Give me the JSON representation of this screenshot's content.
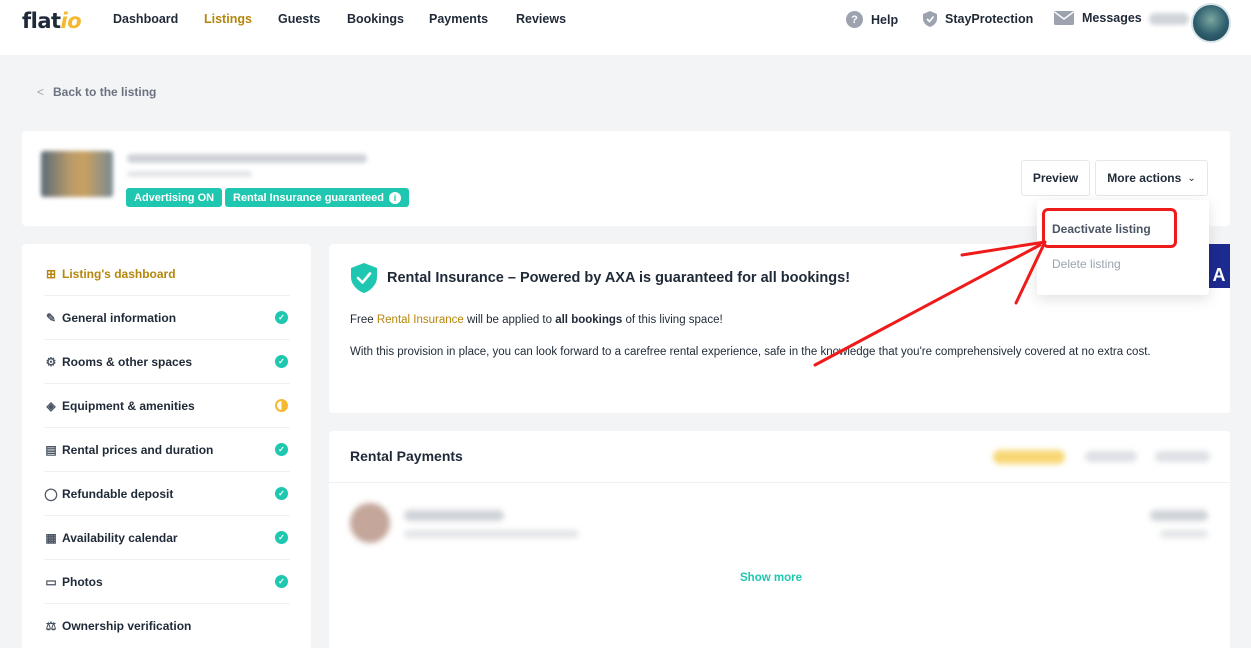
{
  "nav": {
    "logo_main": "flat",
    "logo_accent": "io",
    "links": [
      "Dashboard",
      "Listings",
      "Guests",
      "Bookings",
      "Payments",
      "Reviews"
    ],
    "active": "Listings",
    "help": "Help",
    "protection": "StayProtection",
    "messages": "Messages"
  },
  "back_link": "Back to the listing",
  "listing": {
    "badges": [
      "Advertising ON",
      "Rental Insurance guaranteed"
    ],
    "preview_label": "Preview",
    "more_actions_label": "More actions",
    "menu": [
      "Deactivate listing",
      "Delete listing"
    ]
  },
  "sidebar": {
    "items": [
      {
        "label": "Listing's dashboard",
        "icon": "grid-icon",
        "status": "none"
      },
      {
        "label": "General information",
        "icon": "pencil-icon",
        "status": "complete"
      },
      {
        "label": "Rooms & other spaces",
        "icon": "hierarchy-icon",
        "status": "complete"
      },
      {
        "label": "Equipment & amenities",
        "icon": "layers-icon",
        "status": "partial"
      },
      {
        "label": "Rental prices and duration",
        "icon": "money-icon",
        "status": "complete"
      },
      {
        "label": "Refundable deposit",
        "icon": "shield-icon",
        "status": "complete"
      },
      {
        "label": "Availability calendar",
        "icon": "calendar-icon",
        "status": "complete"
      },
      {
        "label": "Photos",
        "icon": "photo-icon",
        "status": "complete"
      },
      {
        "label": "Ownership verification",
        "icon": "scale-icon",
        "status": "none"
      }
    ]
  },
  "insurance": {
    "title": "Rental Insurance – Powered by AXA is guaranteed for all bookings!",
    "p1_before": "Free ",
    "p1_link": "Rental Insurance",
    "p1_middle": " will be applied to ",
    "p1_bold": "all bookings",
    "p1_after": " of this living space!",
    "p2": "With this provision in place, you can look forward to a carefree rental experience, safe in the knowledge that you're comprehensively covered at no extra cost.",
    "partner_logo_text": "A"
  },
  "payments": {
    "title": "Rental Payments",
    "show_more": "Show more"
  },
  "colors": {
    "accent": "#b5860b",
    "teal": "#1fc7b0",
    "highlight_red": "#ef1b1b"
  }
}
